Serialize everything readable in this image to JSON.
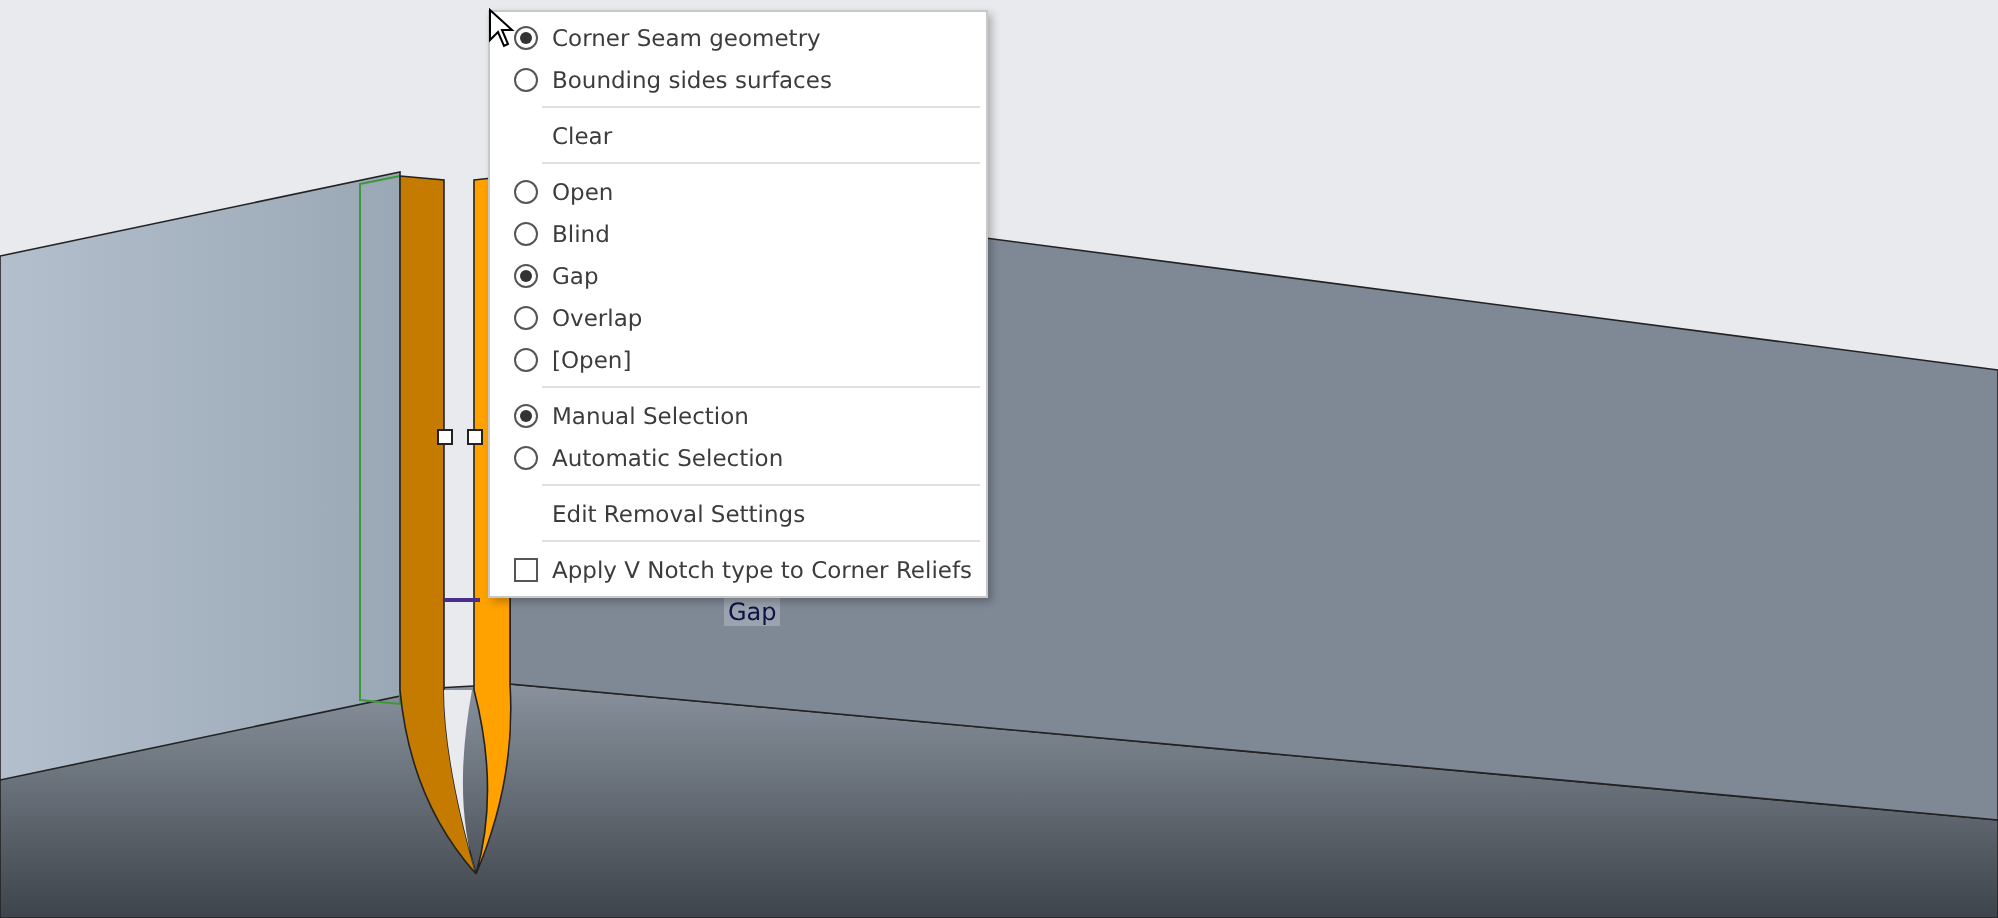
{
  "viewport": {
    "dimension_label": "Gap"
  },
  "context_menu": {
    "items": [
      {
        "kind": "radio",
        "label": "Corner Seam geometry",
        "selected": true
      },
      {
        "kind": "radio",
        "label": "Bounding sides surfaces",
        "selected": false
      },
      {
        "kind": "separator"
      },
      {
        "kind": "command",
        "label": "Clear"
      },
      {
        "kind": "separator"
      },
      {
        "kind": "radio",
        "label": "Open",
        "selected": false
      },
      {
        "kind": "radio",
        "label": "Blind",
        "selected": false
      },
      {
        "kind": "radio",
        "label": "Gap",
        "selected": true
      },
      {
        "kind": "radio",
        "label": "Overlap",
        "selected": false
      },
      {
        "kind": "radio",
        "label": "[Open]",
        "selected": false
      },
      {
        "kind": "separator"
      },
      {
        "kind": "radio",
        "label": "Manual Selection",
        "selected": true
      },
      {
        "kind": "radio",
        "label": "Automatic Selection",
        "selected": false
      },
      {
        "kind": "separator"
      },
      {
        "kind": "command",
        "label": "Edit Removal Settings"
      },
      {
        "kind": "separator"
      },
      {
        "kind": "checkbox",
        "label": "Apply V Notch type to Corner Reliefs",
        "checked": false
      }
    ]
  }
}
